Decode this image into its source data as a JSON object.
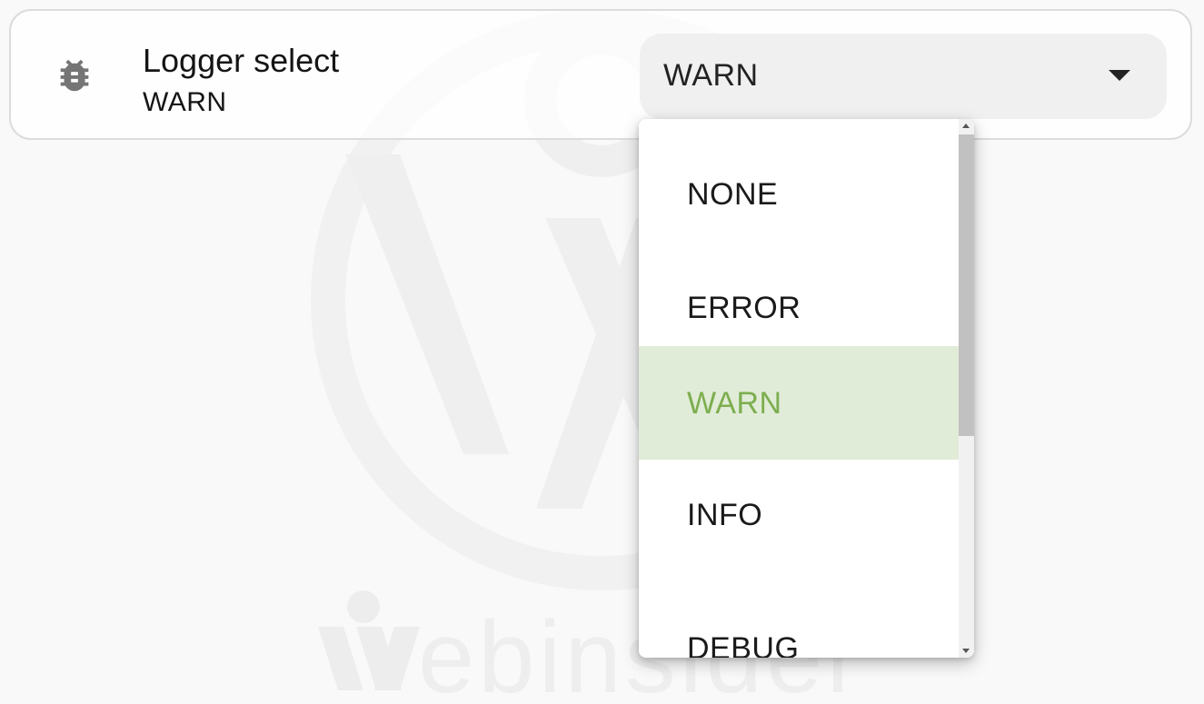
{
  "entity": {
    "icon": "bug-icon",
    "name": "Logger select",
    "state": "WARN"
  },
  "select": {
    "value": "WARN",
    "options": [
      {
        "label": "NONE"
      },
      {
        "label": "ERROR"
      },
      {
        "label": "WARN",
        "selected": true
      },
      {
        "label": "INFO"
      },
      {
        "label": "DEBUG"
      }
    ]
  },
  "colors": {
    "selected_bg": "#e1ecd8",
    "selected_text": "#7dae4f",
    "icon": "#757575"
  }
}
